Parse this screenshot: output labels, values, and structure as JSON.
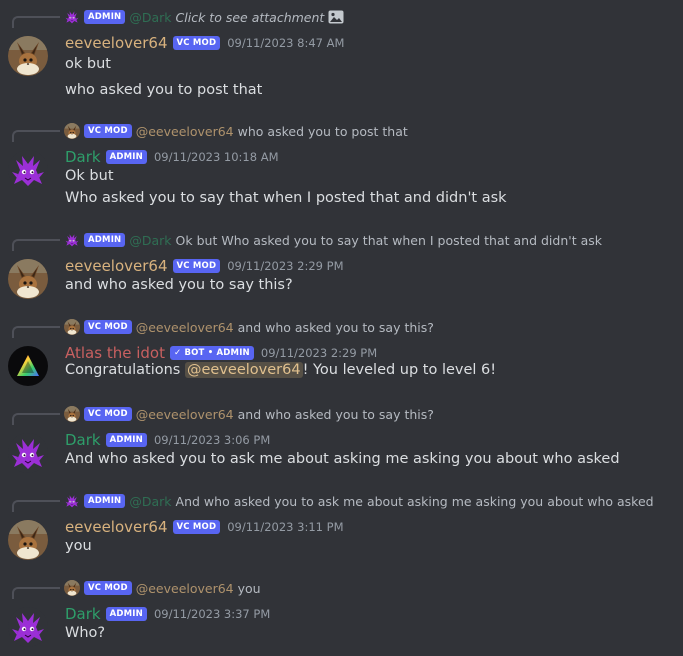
{
  "badges": {
    "admin": "ADMIN",
    "vc_mod": "VC MOD",
    "bot_admin": "✓ BOT • ADMIN"
  },
  "users": {
    "eevee": {
      "name": "eeveelover64",
      "mention": "@eeveelover64",
      "color": "#d8b27e"
    },
    "dark": {
      "name": "Dark",
      "mention": "@Dark",
      "color": "#2e9e6a"
    },
    "atlas": {
      "name": "Atlas the idot",
      "color": "#c86060"
    }
  },
  "messages": [
    {
      "reply": {
        "text": "Click to see attachment"
      },
      "timestamp": "09/11/2023 8:47 AM",
      "lines": [
        "ok but",
        "who asked you to post that"
      ]
    },
    {
      "reply": {
        "text": "who asked you to post that"
      },
      "timestamp": "09/11/2023 10:18 AM",
      "lines": [
        "Ok but",
        "Who asked you to say that when I posted that and didn't ask"
      ]
    },
    {
      "reply": {
        "text": "Ok but Who asked you to say that when I posted that and didn't ask"
      },
      "timestamp": "09/11/2023 2:29 PM",
      "lines": [
        "and who asked you to say this?"
      ]
    },
    {
      "reply": {
        "text": "and who asked you to say this?"
      },
      "timestamp": "09/11/2023 2:29 PM",
      "lines": [
        "Congratulations ",
        "! You leveled up to level 6!"
      ]
    },
    {
      "reply": {
        "text": "and who asked you to say this?"
      },
      "timestamp": "09/11/2023 3:06 PM",
      "lines": [
        "And who asked you to ask me about asking me asking you about who asked"
      ]
    },
    {
      "reply": {
        "text": "And who asked you to ask me about asking me asking you about who asked"
      },
      "timestamp": "09/11/2023 3:11 PM",
      "lines": [
        "you"
      ]
    },
    {
      "reply": {
        "text": "you"
      },
      "timestamp": "09/11/2023 3:37 PM",
      "lines": [
        "Who?"
      ]
    }
  ],
  "icons": {
    "reply_line": "reply-spine",
    "attachment": "image-icon",
    "dark_avatar": "purple-cat-avatar",
    "eevee_avatar": "eevee-avatar",
    "atlas_avatar": "rainbow-triangle-avatar"
  },
  "colors": {
    "background": "#313338",
    "badge": "#5865f2",
    "text": "#dbdee1",
    "muted": "#949ba4"
  }
}
